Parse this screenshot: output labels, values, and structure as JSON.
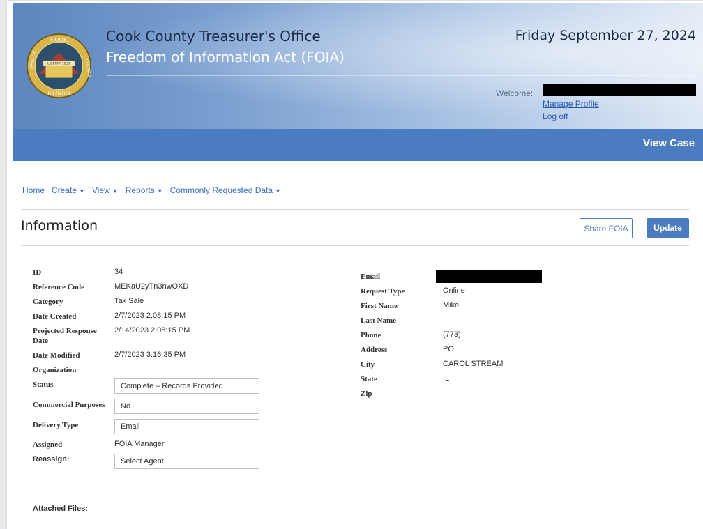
{
  "header": {
    "title_line1": "Cook County Treasurer's Office",
    "title_line2": "Freedom of Information Act (FOIA)",
    "date": "Friday September 27, 2024",
    "seal_text_top": "COOK",
    "seal_text_ribbon": "LIBERTY 1831",
    "seal_text_bottom": "ILLINOIS",
    "seal_text_left": "SEAL OF",
    "seal_text_right": "COUNTY",
    "welcome_label": "Welcome:",
    "manage_profile": "Manage Profile",
    "log_off": "Log off"
  },
  "page_bar": {
    "title": "View Case"
  },
  "nav": {
    "items": [
      {
        "label": "Home",
        "dropdown": false
      },
      {
        "label": "Create",
        "dropdown": true
      },
      {
        "label": "View",
        "dropdown": true
      },
      {
        "label": "Reports",
        "dropdown": true
      },
      {
        "label": "Commonly Requested Data",
        "dropdown": true
      }
    ]
  },
  "section": {
    "heading": "Information",
    "share_button": "Share FOIA",
    "update_button": "Update"
  },
  "left_fields": {
    "id": {
      "label": "ID",
      "value": "34"
    },
    "reference_code": {
      "label": "Reference Code",
      "value": "MEKaU2yTn3nwOXD"
    },
    "category": {
      "label": "Category",
      "value": "Tax Sale"
    },
    "date_created": {
      "label": "Date Created",
      "value": "2/7/2023 2:08:15 PM"
    },
    "projected_response": {
      "label_line1": "Projected Response",
      "label_line2": "Date",
      "value": "2/14/2023 2:08:15 PM"
    },
    "date_modified": {
      "label": "Date Modified",
      "value": "2/7/2023 3:16:35 PM"
    },
    "organization": {
      "label": "Organization",
      "value": ""
    },
    "status": {
      "label": "Status",
      "value": "Complete – Records Provided"
    },
    "commercial": {
      "label": "Commercial Purposes",
      "value": "No"
    },
    "delivery": {
      "label": "Delivery Type",
      "value": "Email"
    },
    "assigned": {
      "label": "Assigned",
      "value": "FOIA Manager"
    },
    "reassign": {
      "label": "Reassign:",
      "value": "Select Agent"
    },
    "attached": {
      "label": "Attached Files:"
    }
  },
  "right_fields": {
    "email": {
      "label": "Email",
      "value": ""
    },
    "request_type": {
      "label": "Request Type",
      "value": "Online"
    },
    "first_name": {
      "label": "First Name",
      "value": "Mike"
    },
    "last_name": {
      "label": "Last Name",
      "value": ""
    },
    "phone": {
      "label": "Phone",
      "value": "(773)"
    },
    "address": {
      "label": "Address",
      "value": "PO"
    },
    "city": {
      "label": "City",
      "value": "CAROL STREAM"
    },
    "state": {
      "label": "State",
      "value": "IL"
    },
    "zip": {
      "label": "Zip",
      "value": ""
    }
  },
  "colors": {
    "primary": "#4b7cc0",
    "link": "#3a6fc0",
    "redaction": "#000000"
  }
}
